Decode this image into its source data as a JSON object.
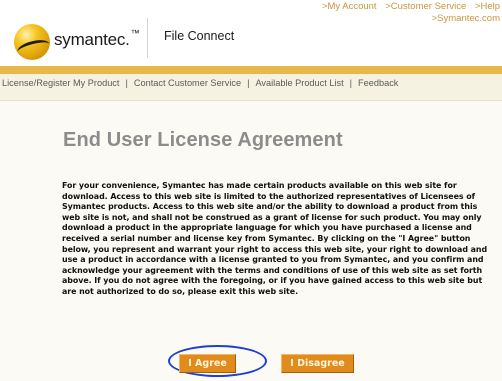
{
  "header": {
    "brand": "symantec.",
    "app_title": "File Connect",
    "top_links": [
      ">My Account",
      ">Customer Service",
      ">Help"
    ],
    "top_link_site": ">Symantec.com"
  },
  "nav": {
    "items": [
      "License/Register My Product",
      "Contact Customer Service",
      "Available Product List",
      "Feedback"
    ],
    "separator": "|"
  },
  "main": {
    "heading": "End User License Agreement",
    "paragraph": "For your convenience, Symantec has made certain products available on this web site for download. Access to this web site is limited to the authorized representatives of Licensees of Symantec products. Access to this web site and/or the ability to download a product from this web site is not, and shall not be construed as a grant of license for such product. You may only download a product in the appropriate language for which you have purchased a license and received a serial number and license key from Symantec. By clicking on the \"I Agree\" button below, you represent and warrant your right to access this web site, your right to download and use a product in accordance with a license granted to you from Symantec, and you confirm and acknowledge your agreement with the terms and conditions of use of this web site as set forth above. If you do not agree with the foregoing, or if you have gained access to this web site but are not authorized to do so, please exit this web site.",
    "agree_label": "I Agree",
    "disagree_label": "I Disagree"
  },
  "colors": {
    "accent_orange": "#e08b1c",
    "rule_yellow": "#e7b94b",
    "highlight_blue": "#1e3fd2",
    "link_gold": "#c8973c"
  },
  "icons": {
    "logo": "symantec-ball-logo"
  }
}
